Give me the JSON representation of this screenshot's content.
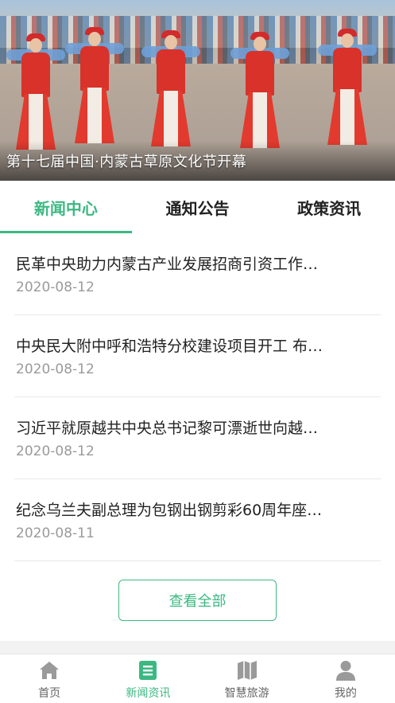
{
  "banner": {
    "caption": "第十七届中国·内蒙古草原文化节开幕"
  },
  "tabs": [
    {
      "label": "新闻中心",
      "active": true
    },
    {
      "label": "通知公告",
      "active": false
    },
    {
      "label": "政策资讯",
      "active": false
    }
  ],
  "news": [
    {
      "title": "民革中央助力内蒙古产业发展招商引资工作…",
      "date": "2020-08-12"
    },
    {
      "title": "中央民大附中呼和浩特分校建设项目开工 布…",
      "date": "2020-08-12"
    },
    {
      "title": "习近平就原越共中央总书记黎可漂逝世向越…",
      "date": "2020-08-12"
    },
    {
      "title": "纪念乌兰夫副总理为包钢出钢剪彩60周年座…",
      "date": "2020-08-11"
    }
  ],
  "view_all_label": "查看全部",
  "bottom_nav": [
    {
      "label": "首页",
      "icon": "home-icon",
      "active": false
    },
    {
      "label": "新闻资讯",
      "icon": "news-icon",
      "active": true
    },
    {
      "label": "智慧旅游",
      "icon": "map-icon",
      "active": false
    },
    {
      "label": "我的",
      "icon": "user-icon",
      "active": false
    }
  ],
  "colors": {
    "accent": "#3cb882",
    "inactive_icon": "#9a9a9a"
  }
}
